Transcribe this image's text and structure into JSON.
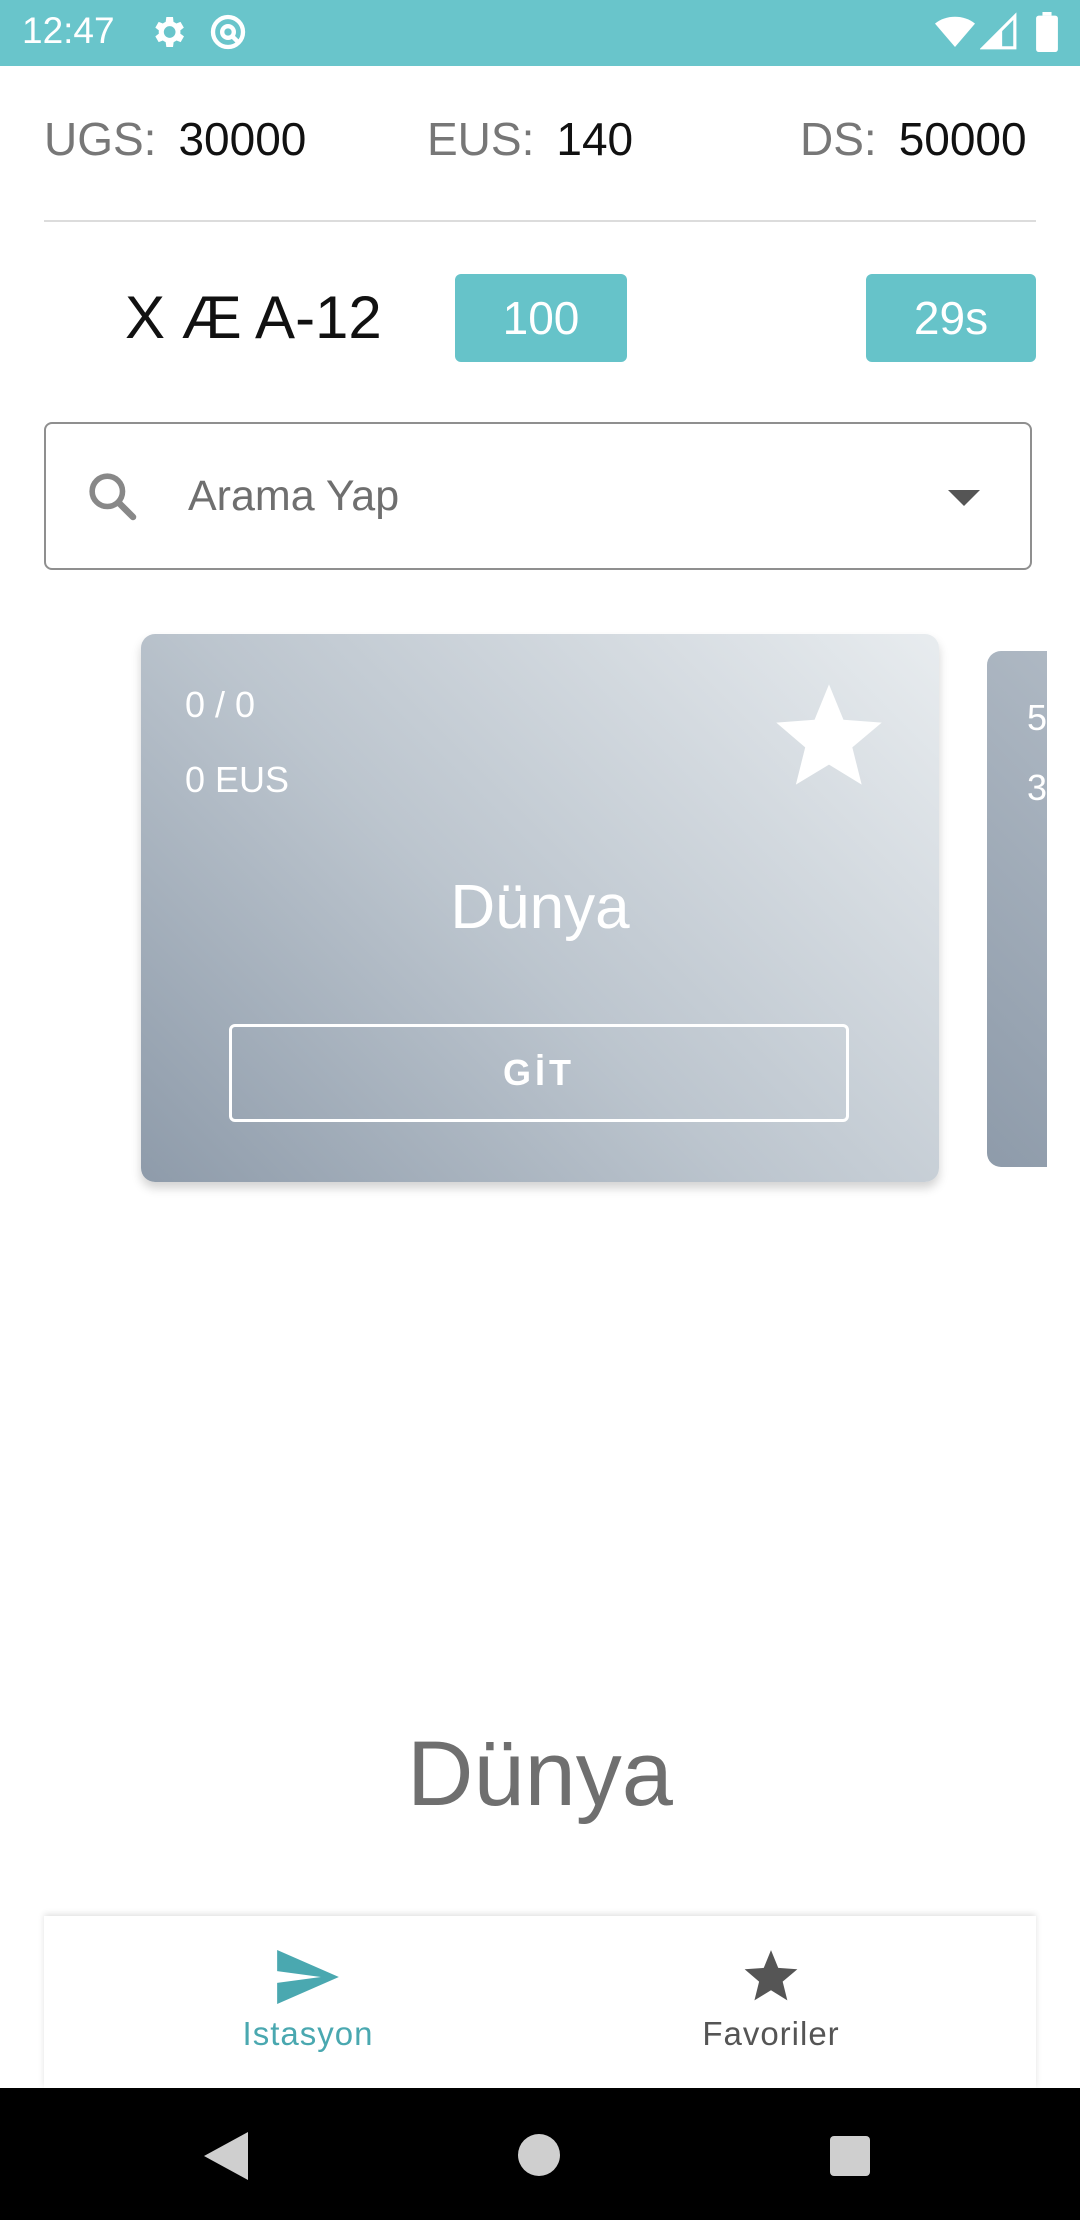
{
  "status_bar": {
    "time": "12:47"
  },
  "stats": [
    {
      "label": "UGS:",
      "value": "30000"
    },
    {
      "label": "EUS:",
      "value": "140"
    },
    {
      "label": "DS:",
      "value": "50000"
    }
  ],
  "ship": {
    "name": "X Æ A-12",
    "value_badge": "100",
    "time_badge": "29s"
  },
  "search": {
    "placeholder": "Arama Yap"
  },
  "cards": [
    {
      "line1": "0 / 0",
      "line2": "0 EUS",
      "name": "Dünya",
      "button": "GİT"
    },
    {
      "line1": "5",
      "line2": "3"
    }
  ],
  "current_station": "Dünya",
  "bottom_nav": [
    {
      "label": "Istasyon",
      "icon": "send-icon",
      "active": true
    },
    {
      "label": "Favoriler",
      "icon": "star-icon",
      "active": false
    }
  ],
  "colors": {
    "accent": "#69c5cb",
    "badge": "#66c3c9",
    "nav_active": "#4aa8b0",
    "nav_inactive": "#555555"
  }
}
